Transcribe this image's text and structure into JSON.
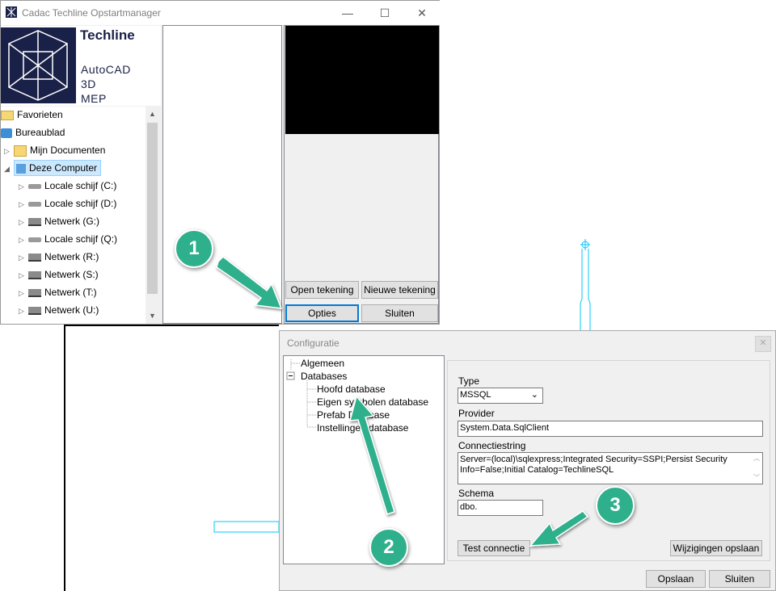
{
  "main_window": {
    "title": "Cadac Techline Opstartmanager",
    "controls": {
      "minimize": "—",
      "maximize": "☐",
      "close": "✕"
    },
    "logo": {
      "brand": "Techline",
      "product_lines": [
        "AutoCAD",
        "3D",
        "MEP"
      ]
    },
    "tree": [
      {
        "label": "Favorieten",
        "icon": "folder-icon"
      },
      {
        "label": "Bureaublad",
        "icon": "desktop-icon"
      },
      {
        "label": "Mijn Documenten",
        "icon": "documents-icon"
      },
      {
        "label": "Deze Computer",
        "icon": "computer-icon"
      },
      {
        "label": "Locale schijf (C:)",
        "icon": "drive-icon"
      },
      {
        "label": "Locale schijf (D:)",
        "icon": "drive-icon"
      },
      {
        "label": "Netwerk (G:)",
        "icon": "network-drive-icon"
      },
      {
        "label": "Locale schijf (Q:)",
        "icon": "drive-icon"
      },
      {
        "label": "Netwerk (R:)",
        "icon": "network-drive-icon"
      },
      {
        "label": "Netwerk (S:)",
        "icon": "network-drive-icon"
      },
      {
        "label": "Netwerk (T:)",
        "icon": "network-drive-icon"
      },
      {
        "label": "Netwerk (U:)",
        "icon": "network-drive-icon"
      }
    ],
    "buttons": {
      "open_drawing": "Open tekening",
      "new_drawing": "Nieuwe tekening",
      "options": "Opties",
      "close": "Sluiten"
    }
  },
  "config_dialog": {
    "title": "Configuratie",
    "close_glyph": "✕",
    "tree": {
      "general": "Algemeen",
      "databases": "Databases",
      "children": [
        "Hoofd database",
        "Eigen symbolen database",
        "Prefab Database",
        "Instellingen database"
      ]
    },
    "form": {
      "type_label": "Type",
      "type_value": "MSSQL",
      "provider_label": "Provider",
      "provider_value": "System.Data.SqlClient",
      "connstring_label": "Connectiestring",
      "connstring_value": "Server=(local)\\sqlexpress;Integrated Security=SSPI;Persist Security Info=False;Initial Catalog=TechlineSQL",
      "schema_label": "Schema",
      "schema_value": "dbo.",
      "test_button": "Test connectie",
      "save_changes_button": "Wijzigingen opslaan"
    },
    "footer": {
      "save": "Opslaan",
      "close": "Sluiten"
    }
  },
  "callouts": [
    "1",
    "2",
    "3"
  ],
  "colors": {
    "callout": "#2fb08c",
    "cad_cyan": "#00c8ff",
    "logo_navy": "#1a2148"
  }
}
